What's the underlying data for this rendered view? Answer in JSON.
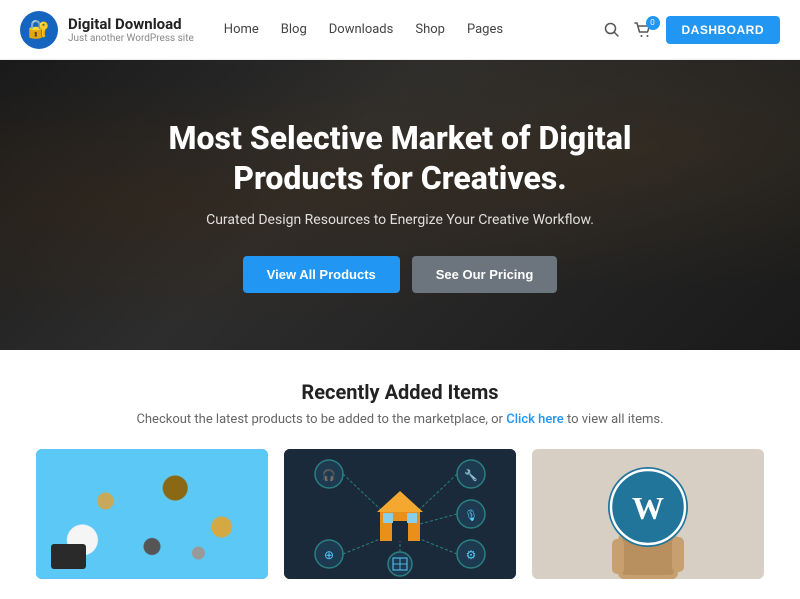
{
  "navbar": {
    "logo_title": "Digital Download",
    "logo_subtitle": "Just another WordPress site",
    "nav_links": [
      {
        "label": "Home",
        "id": "home"
      },
      {
        "label": "Blog",
        "id": "blog"
      },
      {
        "label": "Downloads",
        "id": "downloads"
      },
      {
        "label": "Shop",
        "id": "shop"
      },
      {
        "label": "Pages",
        "id": "pages"
      }
    ],
    "cart_count": "0",
    "dashboard_label": "DASHBOARD"
  },
  "hero": {
    "title": "Most Selective Market of Digital Products for Creatives.",
    "subtitle": "Curated Design Resources to Energize Your Creative Workflow.",
    "btn_primary": "View All Products",
    "btn_secondary": "See Our Pricing"
  },
  "recently": {
    "title": "Recently Added Items",
    "subtitle_pre": "Checkout the latest products to be added to the marketplace, or ",
    "subtitle_link": "Click here",
    "subtitle_post": " to view all items.",
    "products": [
      {
        "id": "product-1",
        "type": "flatlay"
      },
      {
        "id": "product-2",
        "type": "smarthome"
      },
      {
        "id": "product-3",
        "type": "wordpress"
      }
    ]
  },
  "colors": {
    "primary": "#2196f3",
    "dark": "#1a1a1a",
    "text": "#222",
    "muted": "#666"
  }
}
